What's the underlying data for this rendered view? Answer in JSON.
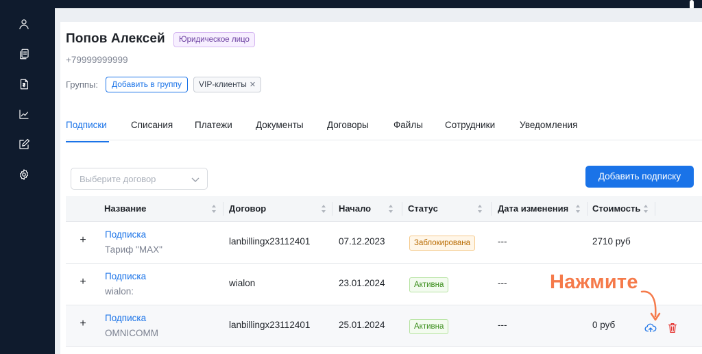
{
  "client": {
    "name": "Попов Алексей",
    "type_badge": "Юридическое лицо",
    "phone": "+79999999999",
    "groups_label": "Группы:",
    "add_group_label": "Добавить в группу",
    "group_tags": [
      "VIP-клиенты"
    ]
  },
  "tabs": [
    "Подписки",
    "Списания",
    "Платежи",
    "Документы",
    "Договоры",
    "Файлы",
    "Сотрудники",
    "Уведомления"
  ],
  "active_tab": "Подписки",
  "toolbar": {
    "contract_placeholder": "Выберите договор",
    "add_subscription_label": "Добавить подписку"
  },
  "table": {
    "columns": [
      "Название",
      "Договор",
      "Начало",
      "Статус",
      "Дата изменения",
      "Стоимость"
    ],
    "rows": [
      {
        "title": "Подписка",
        "subtitle": "Тариф \"MAX\"",
        "contract": "lanbillingx23112401",
        "start": "07.12.2023",
        "status": "Заблокирована",
        "changed": "---",
        "cost": "2710 руб"
      },
      {
        "title": "Подписка",
        "subtitle": "wialon:",
        "contract": "wialon",
        "start": "23.01.2024",
        "status": "Активна",
        "changed": "---",
        "cost": ""
      },
      {
        "title": "Подписка",
        "subtitle": "OMNICOMM",
        "contract": "lanbillingx23112401",
        "start": "25.01.2024",
        "status": "Активна",
        "changed": "---",
        "cost": "0 руб"
      }
    ]
  },
  "annotation": {
    "text": "Нажмите",
    "color": "#f57a4a"
  },
  "colors": {
    "sidebar": "#0f1b2d",
    "accent": "#1a73e8",
    "danger": "#e53935"
  },
  "sidebar_icons": [
    "user-icon",
    "documents-icon",
    "invoice-icon",
    "chart-icon",
    "edit-icon",
    "settings-icon"
  ]
}
